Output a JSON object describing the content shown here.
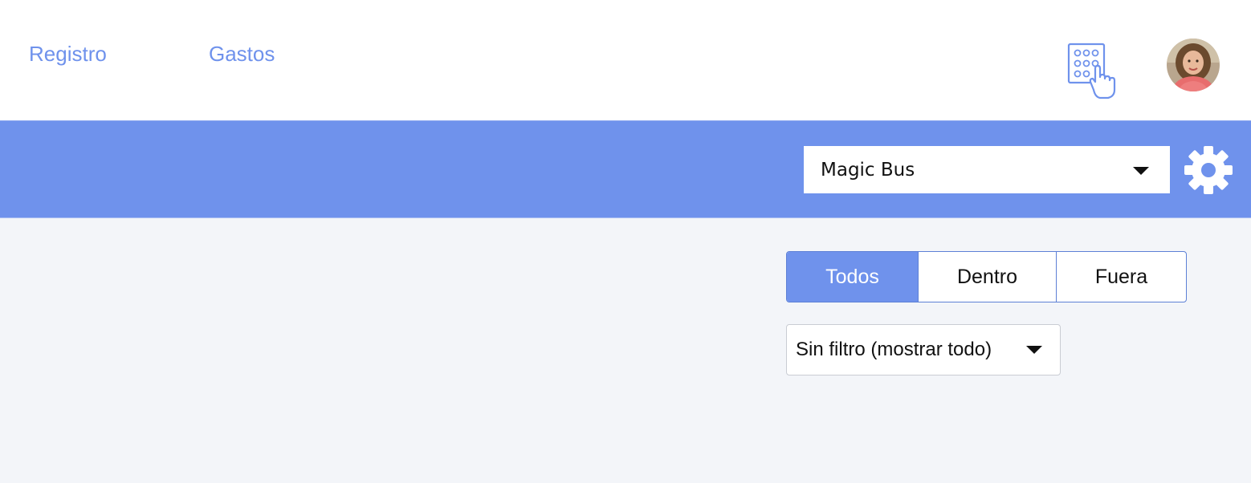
{
  "nav": {
    "links": [
      {
        "label": "Registro"
      },
      {
        "label": "Gastos"
      }
    ]
  },
  "header": {
    "keypad_icon": "keypad-hand-icon",
    "avatar_icon": "user-avatar"
  },
  "toolbar": {
    "vehicle_select": {
      "value": "Magic Bus"
    },
    "settings_icon": "gear-icon"
  },
  "segmented": {
    "options": [
      {
        "label": "Todos",
        "active": true
      },
      {
        "label": "Dentro",
        "active": false
      },
      {
        "label": "Fuera",
        "active": false
      }
    ]
  },
  "filter": {
    "value": "Sin filtro (mostrar todo)"
  },
  "colors": {
    "accent": "#6f92ec",
    "background": "#f3f5f9",
    "white": "#ffffff"
  }
}
